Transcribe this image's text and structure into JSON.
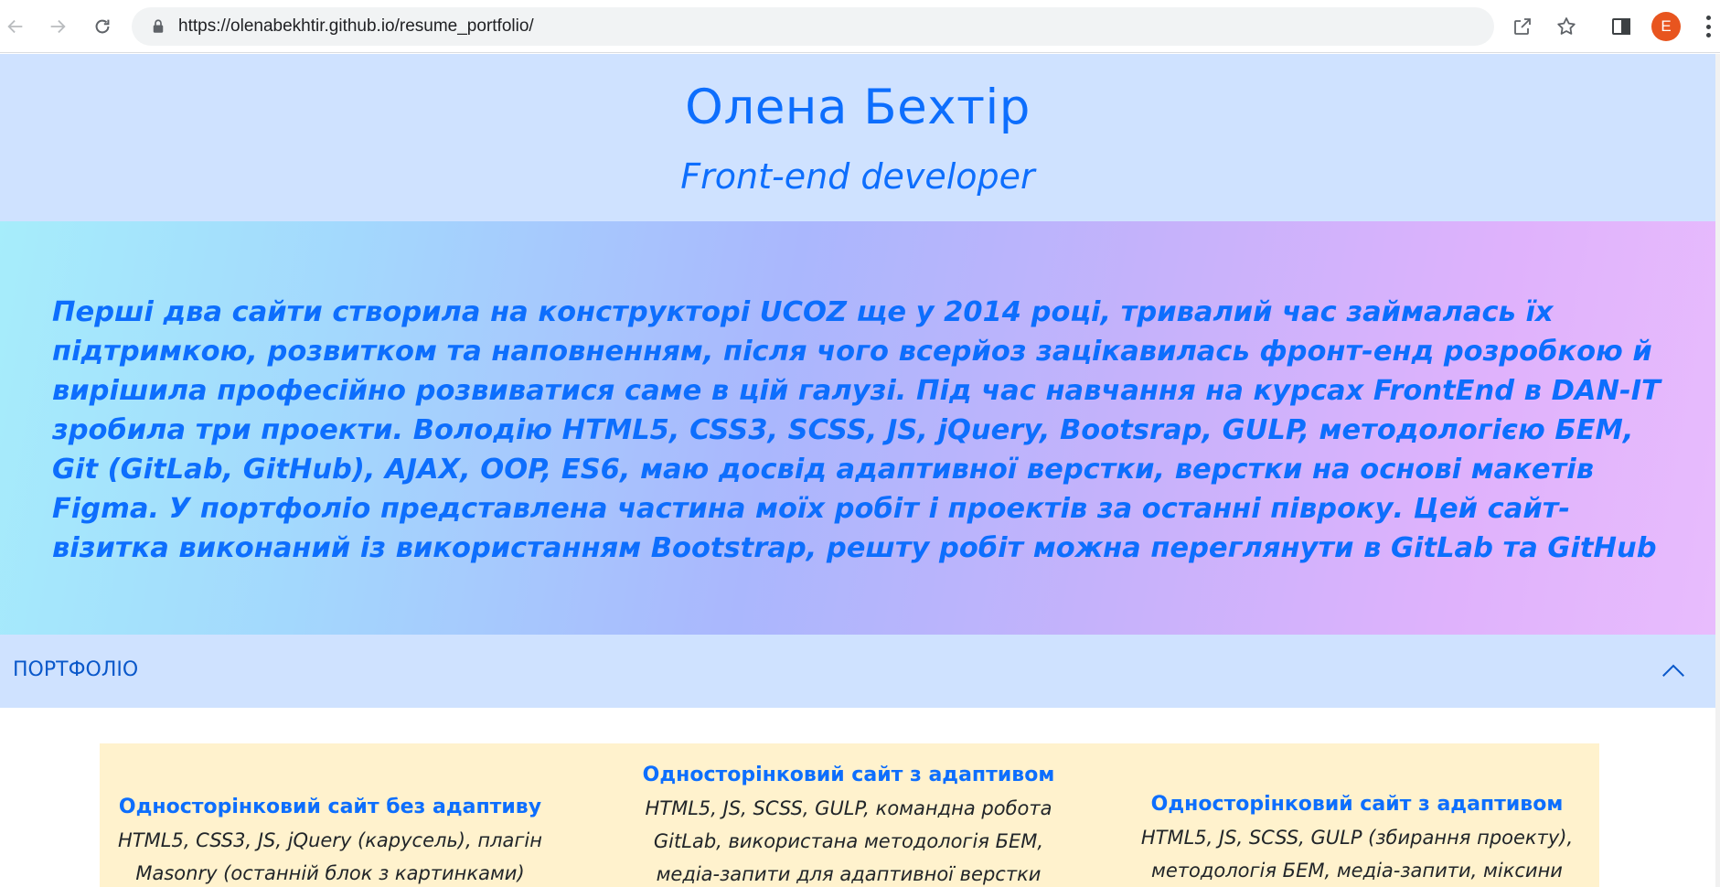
{
  "browser": {
    "url": "https://olenabekhtir.github.io/resume_portfolio/",
    "profile_initial": "E",
    "icons": [
      "back-icon",
      "forward-icon",
      "reload-icon",
      "lock-icon",
      "share-icon",
      "star-icon",
      "side-panel-icon",
      "menu-icon"
    ]
  },
  "hero": {
    "name": "Олена Бехтір",
    "role": "Front-end developer"
  },
  "about": {
    "text": "Перші два сайти створила на конструкторі UCOZ ще у 2014 році, тривалий час займалась їх підтримкою, розвитком та наповненням, після чого всерйоз зацікавилась фронт-енд розробкою й вирішила професійно розвиватися саме в цій галузі. Під час навчання на курсах FrontEnd в DAN-IT зробила три проекти. Володію HTML5, CSS3, SCSS, JS, jQuery, Bootsrap, GULP, методологією БЕМ, Git (GitLab, GitHub), AJAX, OOP, ES6, маю досвід адаптивної верстки, верстки на основі макетів Figma. У портфоліо представлена частина моїх робіт і проектів за останні півроку. Цей сайт-візитка виконаний із використанням Bootstrap, решту робіт можна переглянути в GitLab та GitHub"
  },
  "portfolio": {
    "label": "ПОРТФОЛІО",
    "expanded": true,
    "cards": [
      {
        "title": "Односторінковий сайт без адаптиву",
        "desc_lines": [
          "HTML5, CSS3, JS, jQuery (карусель), плагін",
          "Masonry (останній блок з картинками)"
        ]
      },
      {
        "title": "Односторінковий сайт з адаптивом",
        "desc_lines": [
          "HTML5, JS, SCSS, GULP, командна робота",
          "GitLab, використана методологія БЕМ,",
          "медіа-запити для адаптивної верстки"
        ]
      },
      {
        "title": "Односторінковий сайт з адаптивом",
        "desc_lines": [
          "HTML5, JS, SCSS, GULP (збирання проекту),",
          "методологія БЕМ, медіа-запити, міксини"
        ]
      }
    ]
  },
  "colors": {
    "primary": "#0d6efd",
    "hero_bg": "#cfe2ff",
    "portfolio_bg": "#fff2cd",
    "avatar_bg": "#e8551f"
  }
}
